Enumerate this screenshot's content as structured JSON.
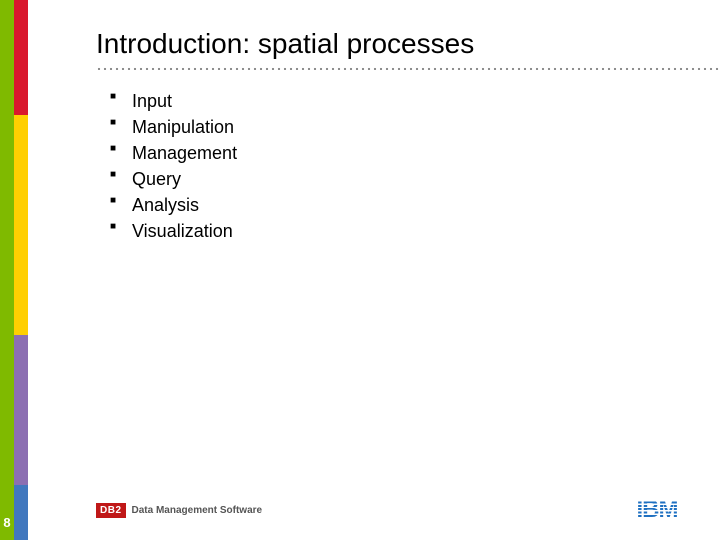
{
  "slide": {
    "title": "Introduction: spatial processes",
    "bullets": [
      "Input",
      "Manipulation",
      "Management",
      "Query",
      "Analysis",
      "Visualization"
    ],
    "page_number": "8"
  },
  "footer": {
    "badge": "DB2",
    "product": "Data Management Software",
    "company": "IBM"
  },
  "colors": {
    "green": "#7fba00",
    "red": "#d9182d",
    "yellow": "#ffcf01",
    "purple": "#8c6fb2",
    "blue": "#4178be",
    "ibm_blue": "#1f70c1",
    "badge_red": "#c01818"
  }
}
